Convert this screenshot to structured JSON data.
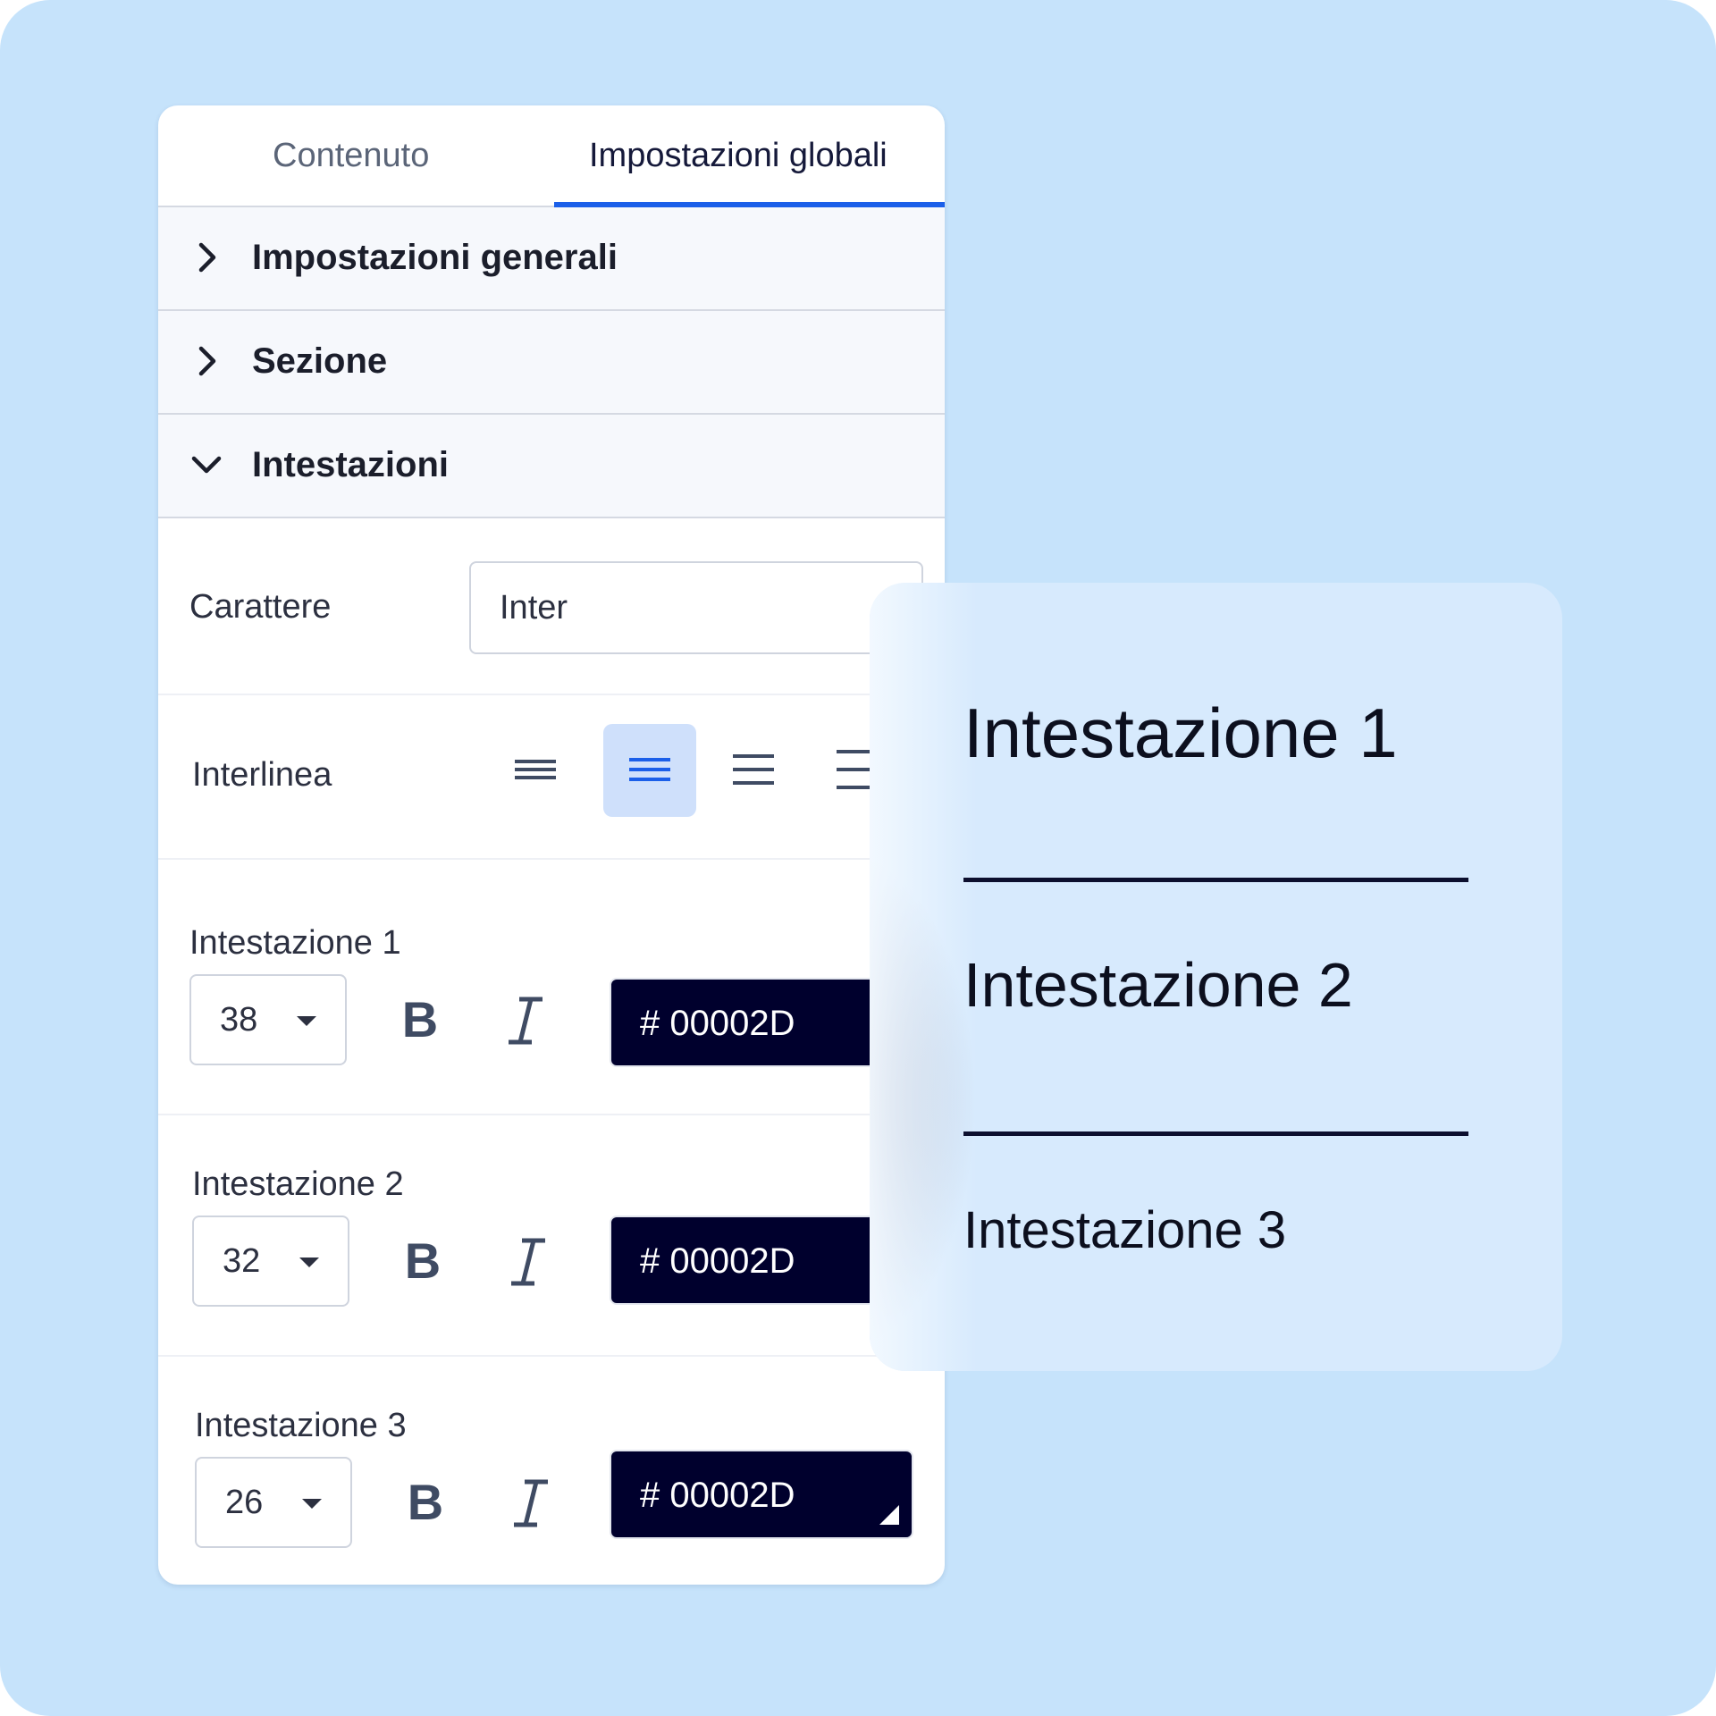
{
  "tabs": [
    {
      "label": "Contenuto",
      "active": false
    },
    {
      "label": "Impostazioni globali",
      "active": true
    }
  ],
  "accordion": [
    {
      "label": "Impostazioni generali",
      "expanded": false
    },
    {
      "label": "Sezione",
      "expanded": false
    },
    {
      "label": "Intestazioni",
      "expanded": true
    }
  ],
  "font": {
    "label": "Carattere",
    "value": "Inter"
  },
  "line_spacing": {
    "label": "Interlinea",
    "options": [
      "compact",
      "normal",
      "relaxed",
      "loose"
    ],
    "selected": "normal"
  },
  "headings": [
    {
      "label": "Intestazione 1",
      "size": "38",
      "bold": "B",
      "italic": "I",
      "color": "# 00002D"
    },
    {
      "label": "Intestazione 2",
      "size": "32",
      "bold": "B",
      "italic": "I",
      "color": "# 00002D"
    },
    {
      "label": "Intestazione 3",
      "size": "26",
      "bold": "B",
      "italic": "I",
      "color": "# 00002D"
    }
  ],
  "preview": {
    "h1": "Intestazione 1",
    "h2": "Intestazione 2",
    "h3": "Intestazione 3"
  },
  "colors": {
    "background": "#c6e3fb",
    "accent": "#1b5fe9",
    "heading_color": "#00002d",
    "selected_option": "#cfe0fb"
  }
}
